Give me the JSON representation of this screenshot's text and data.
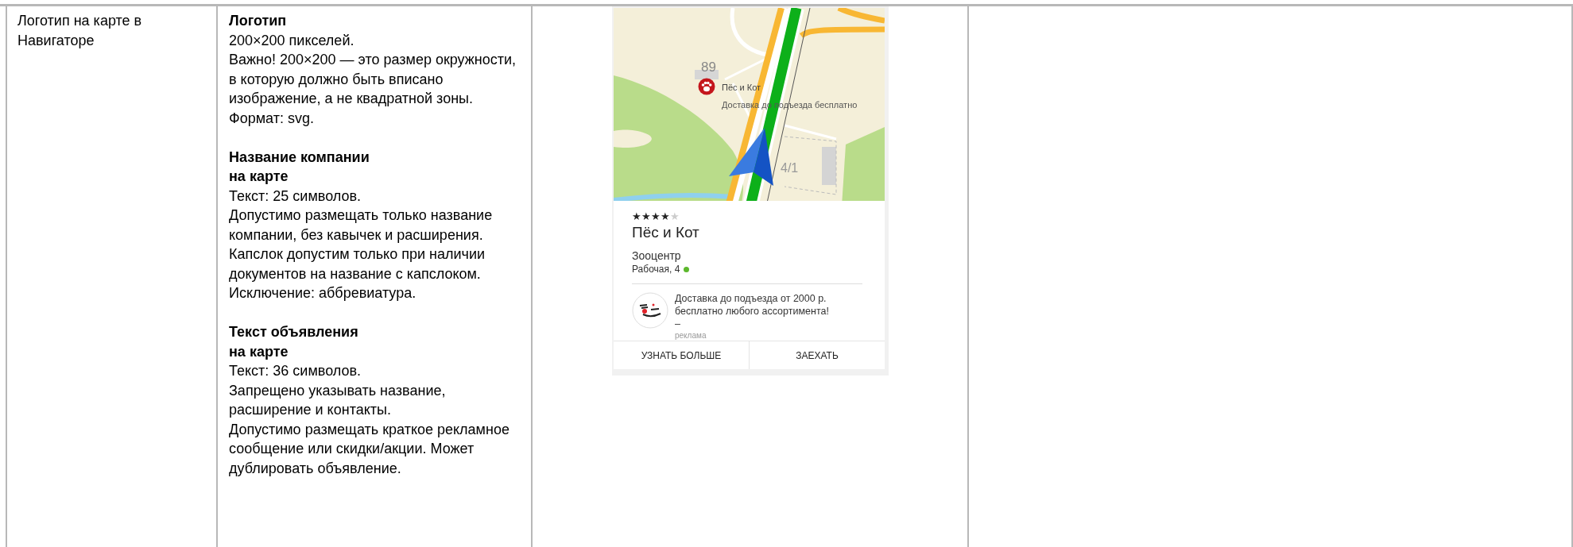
{
  "row": {
    "feature": "Логотип на карте в Навигаторе",
    "sections": [
      {
        "heading_lines": [
          "Логотип"
        ],
        "paragraphs": [
          "200×200 пикселей.",
          "Важно! 200×200 — это размер окружности, в которую должно быть вписано изображение, а не квадратной зоны.",
          "Формат: svg."
        ]
      },
      {
        "heading_lines": [
          "Название компании",
          "на карте"
        ],
        "paragraphs": [
          "Текст: 25 символов.",
          "Допустимо размещать только название компании, без кавычек и расширения. Капслок допустим только при наличии документов на название с капслоком. Исключение: аббревиатура."
        ]
      },
      {
        "heading_lines": [
          "Текст объявления",
          "на карте"
        ],
        "paragraphs": [
          "Текст: 36 символов.",
          "Запрещено указывать название, расширение и контакты.",
          "Допустимо размещать краткое рекламное сообщение или скидки/акции. Может дублировать объявление."
        ]
      }
    ],
    "screenshot": {
      "map": {
        "house_number": "89",
        "place_name": "Пёс и Кот",
        "place_ad": "Доставка до подъезда бесплатно",
        "house_number_2": "4/1"
      },
      "card": {
        "stars": 4,
        "name": "Пёс и Кот",
        "category": "Зооцентр",
        "address": "Рабочая, 4",
        "open": true,
        "ad_text": "Доставка до подъезда от 2000 р. бесплатно любого ассортимента! –",
        "ad_label": "реклама"
      },
      "buttons": [
        "УЗНАТЬ БОЛЬШЕ",
        "ЗАЕХАТЬ"
      ]
    }
  }
}
